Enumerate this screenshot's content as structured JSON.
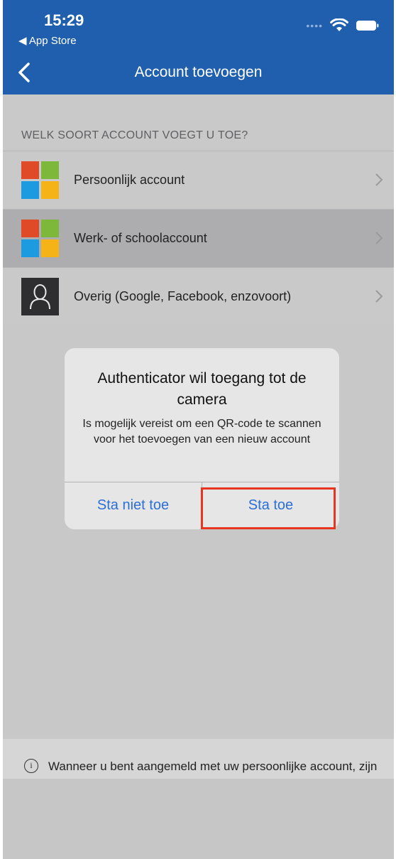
{
  "status_bar": {
    "time": "15:29",
    "back_app": "◀ App Store"
  },
  "nav": {
    "title": "Account toevoegen"
  },
  "section": {
    "header": "WELK SOORT ACCOUNT VOEGT U TOE?"
  },
  "accounts": [
    {
      "label": "Persoonlijk account",
      "icon": "microsoft-logo-icon"
    },
    {
      "label": "Werk- of schoolaccount",
      "icon": "microsoft-logo-icon"
    },
    {
      "label": "Overig (Google, Facebook, enzovoort)",
      "icon": "user-icon"
    }
  ],
  "alert": {
    "title": "Authenticator wil toegang tot de camera",
    "message": "Is mogelijk vereist om een QR-code te scannen voor het toevoegen van een nieuw account",
    "deny_label": "Sta niet toe",
    "allow_label": "Sta toe"
  },
  "footer": {
    "info_icon": "i",
    "text": "Wanneer u bent aangemeld met uw persoonlijke account, zijn alle opgeslagen wachtwoorden, adressen en andere gegevens voor automatisch invullen beschikbaar op dit apparaat."
  },
  "colors": {
    "header_bg": "#1f5fad",
    "link_blue": "#2b6fd6",
    "highlight_red": "#e8351f"
  }
}
